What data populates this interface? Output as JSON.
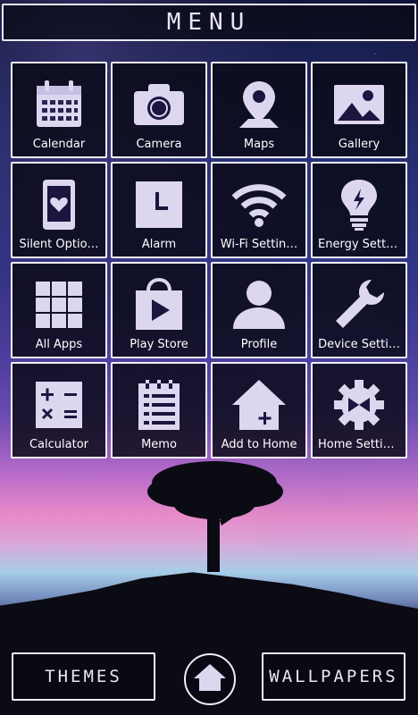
{
  "header": {
    "title": "MENU"
  },
  "tiles": [
    {
      "label": "Calendar",
      "icon": "calendar-icon"
    },
    {
      "label": "Camera",
      "icon": "camera-icon"
    },
    {
      "label": "Maps",
      "icon": "map-pin-icon"
    },
    {
      "label": "Gallery",
      "icon": "image-icon"
    },
    {
      "label": "Silent Optio…",
      "icon": "phone-heart-icon"
    },
    {
      "label": "Alarm",
      "icon": "clock-icon"
    },
    {
      "label": "Wi-Fi Settin…",
      "icon": "wifi-icon"
    },
    {
      "label": "Energy Setti…",
      "icon": "lightbulb-icon"
    },
    {
      "label": "All Apps",
      "icon": "grid-icon"
    },
    {
      "label": "Play Store",
      "icon": "play-store-icon"
    },
    {
      "label": "Profile",
      "icon": "person-icon"
    },
    {
      "label": "Device Setti…",
      "icon": "wrench-icon"
    },
    {
      "label": "Calculator",
      "icon": "calculator-icon"
    },
    {
      "label": "Memo",
      "icon": "notepad-icon"
    },
    {
      "label": "Add to Home",
      "icon": "add-home-icon"
    },
    {
      "label": "Home Settin…",
      "icon": "gear-icon"
    }
  ],
  "footer": {
    "themes_label": "THEMES",
    "wallpapers_label": "WALLPAPERS"
  },
  "colors": {
    "icon_fill": "#ddd6ef",
    "border": "#f0eef8",
    "text": "#ffffff"
  }
}
